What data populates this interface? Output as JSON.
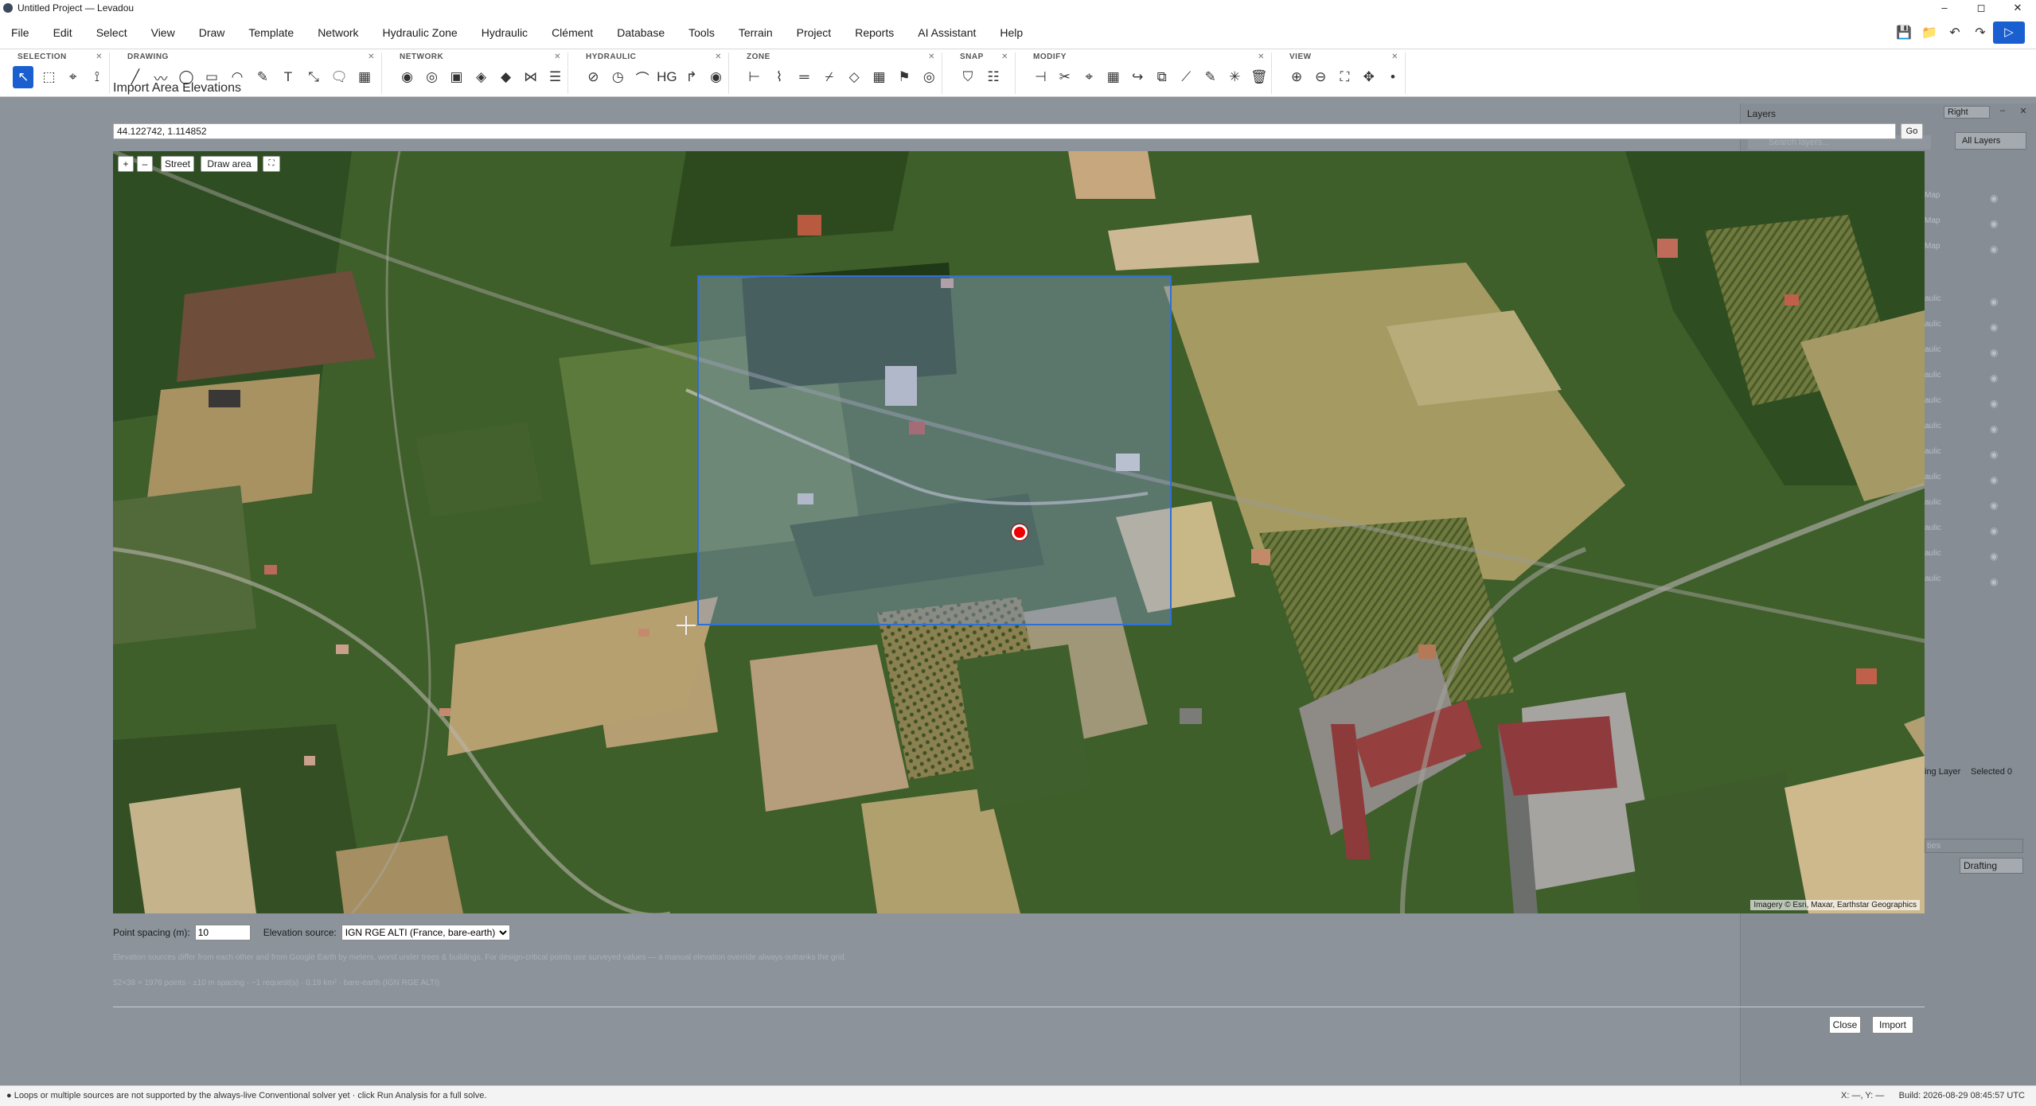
{
  "window": {
    "title": "Untitled Project — Levadou",
    "controls": [
      "–",
      "◻",
      "✕"
    ]
  },
  "menu": [
    "File",
    "Edit",
    "Select",
    "View",
    "Draw",
    "Template",
    "Network",
    "Hydraulic Zone",
    "Hydraulic",
    "Clément",
    "Database",
    "Tools",
    "Terrain",
    "Project",
    "Reports",
    "AI Assistant",
    "Help"
  ],
  "menu_right_icons": {
    "save": "💾",
    "open": "📁",
    "undo": "↶",
    "redo": "↷",
    "run": "▷"
  },
  "toolbar": {
    "groups": [
      {
        "title": "SELECTION",
        "icons": [
          "↖",
          "⬚",
          "⌖",
          "⟟"
        ]
      },
      {
        "title": "DRAWING",
        "icons": [
          "╱",
          "〰",
          "◯",
          "▭",
          "◠",
          "✎",
          "T",
          "⤡",
          "🗨",
          "▦"
        ]
      },
      {
        "title": "NETWORK",
        "icons": [
          "◉",
          "◎",
          "▣",
          "◈",
          "◆",
          "⋈",
          "☰"
        ]
      },
      {
        "title": "HYDRAULIC",
        "icons": [
          "⊘",
          "◷",
          "⌒",
          "HG",
          "↱",
          "◉"
        ]
      },
      {
        "title": "ZONE",
        "icons": [
          "⊢",
          "⌇",
          "═",
          "⌿",
          "◇",
          "▦",
          "⚑",
          "◎"
        ]
      },
      {
        "title": "SNAP",
        "icons": [
          "⛉",
          "☷"
        ]
      },
      {
        "title": "MODIFY",
        "icons": [
          "⊣",
          "✂",
          "⌖",
          "▦",
          "↪",
          "⧉",
          "⟋",
          "✎",
          "✳",
          "🗑"
        ]
      },
      {
        "title": "VIEW",
        "icons": [
          "⊕",
          "⊖",
          "⛶",
          "✥",
          "•"
        ]
      }
    ]
  },
  "dialog": {
    "title": "Import Area Elevations",
    "coord_value": "44.122742, 1.114852",
    "go_label": "Go",
    "map_controls": {
      "zoom_in": "+",
      "zoom_out": "–",
      "street": "Street",
      "draw_area": "Draw area",
      "fullscreen": "⛶"
    },
    "attribution": "Imagery © Esri, Maxar, Earthstar Geographics",
    "point_spacing_label": "Point spacing (m):",
    "point_spacing_value": "10",
    "elevation_source_label": "Elevation source:",
    "elevation_source_value": "IGN RGE ALTI (France, bare-earth)",
    "note_line1": "Elevation sources differ from each other and from Google Earth by meters, worst under trees & buildings. For design-critical points use surveyed values — a manual elevation override always outranks the grid.",
    "note_line2": "52×38 = 1976 points · ±10 m spacing · ~1 request(s) · 0.19 km² · bare-earth (IGN RGE ALTI)",
    "close_label": "Close",
    "import_label": "Import"
  },
  "layers_panel": {
    "title": "Layers",
    "position_value": "Right",
    "search_placeholder": "Search layers...",
    "filter_value": "All Layers",
    "row_labels": [
      "Map",
      "Map",
      "Map",
      "aulic",
      "aulic",
      "aulic",
      "aulic",
      "aulic",
      "aulic",
      "aulic",
      "aulic",
      "aulic",
      "aulic",
      "aulic",
      "aulic"
    ],
    "footer_layer": "ing Layer",
    "footer_selected": "Selected 0",
    "props_placeholder": "ties",
    "mode_value": "Drafting"
  },
  "status": {
    "left": "● Loops or multiple sources are not supported by the always-live Conventional solver yet · click Run Analysis for a full solve.",
    "coords": "X: —, Y: —",
    "build": "Build: 2026-08-29 08:45:57 UTC"
  },
  "colors": {
    "accent": "#1a5fd0",
    "selection_fill": "#8ca0d7",
    "marker": "#e00000"
  }
}
